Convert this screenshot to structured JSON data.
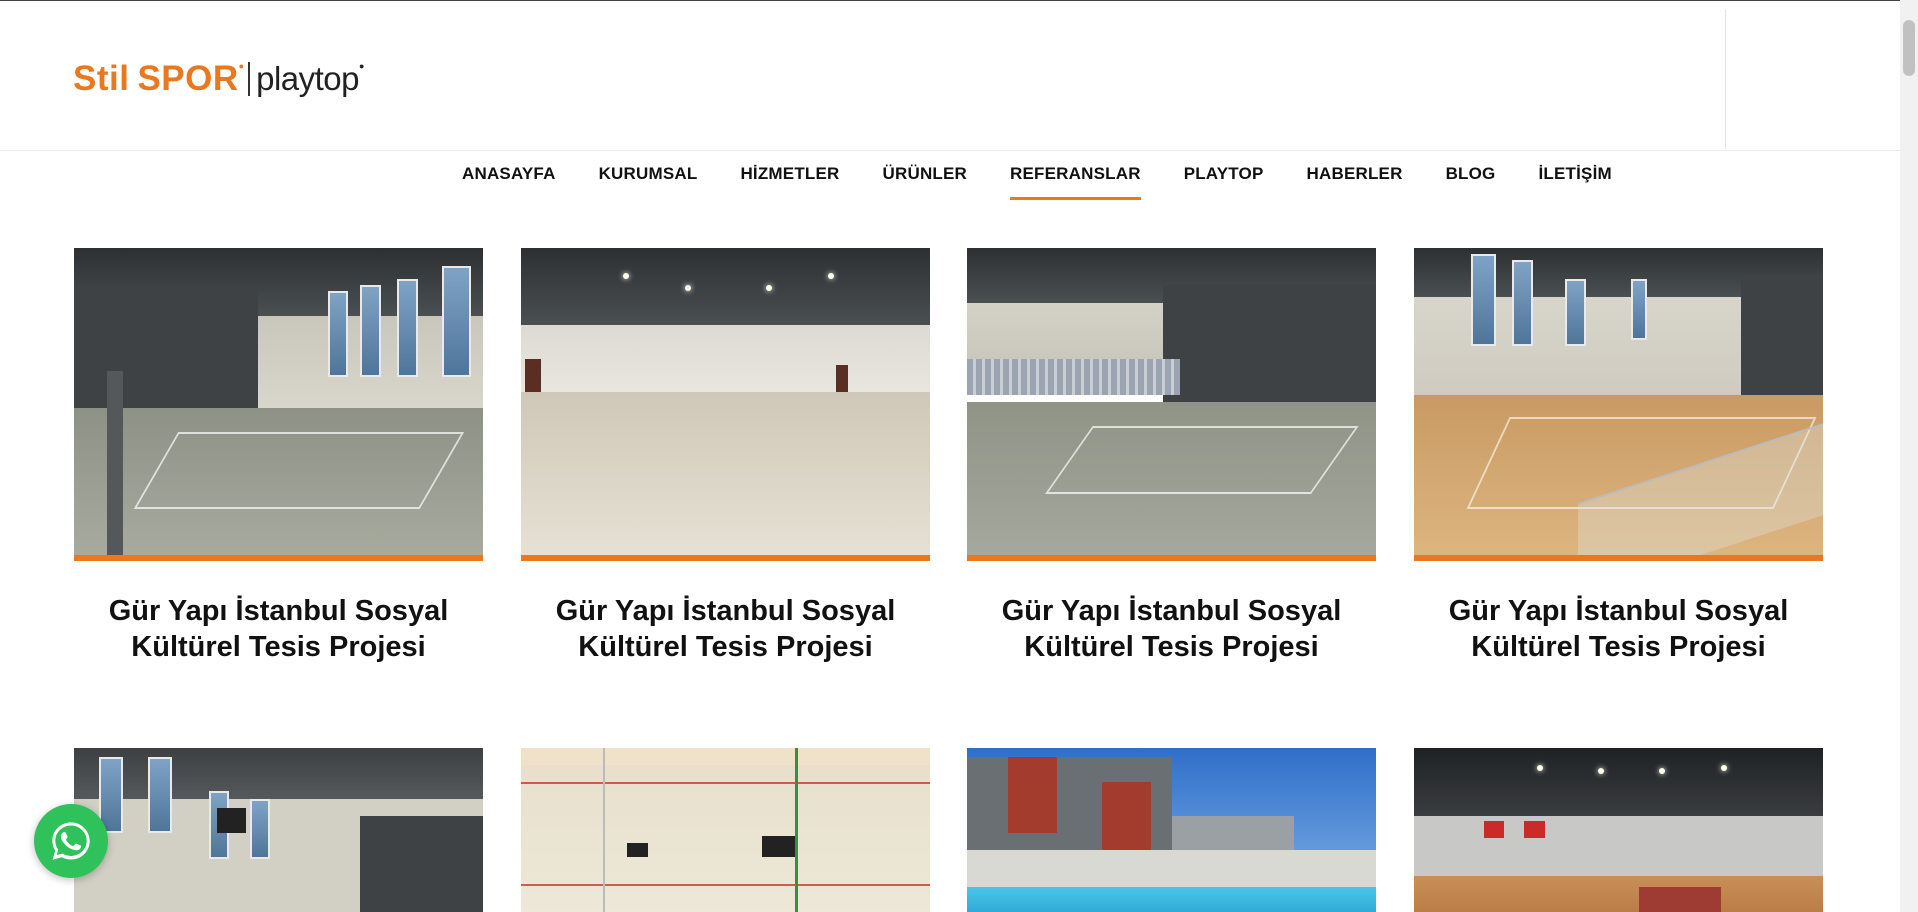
{
  "brand": {
    "logo_part1": "Stil",
    "logo_part2": "SPOR",
    "logo_part3": "playtop",
    "accent_color": "#e9781f"
  },
  "nav": {
    "items": [
      {
        "label": "ANASAYFA",
        "active": false
      },
      {
        "label": "KURUMSAL",
        "active": false
      },
      {
        "label": "HİZMETLER",
        "active": false
      },
      {
        "label": "ÜRÜNLER",
        "active": false
      },
      {
        "label": "REFERANSLAR",
        "active": true
      },
      {
        "label": "PLAYTOP",
        "active": false
      },
      {
        "label": "HABERLER",
        "active": false
      },
      {
        "label": "BLOG",
        "active": false
      },
      {
        "label": "İLETİŞİM",
        "active": false
      }
    ]
  },
  "references": {
    "row1": [
      {
        "title": "Gür Yapı İstanbul Sosyal Kültürel Tesis Projesi",
        "image": "indoor sports hall green court"
      },
      {
        "title": "Gür Yapı İstanbul Sosyal Kültürel Tesis Projesi",
        "image": "empty hall light wood floor"
      },
      {
        "title": "Gür Yapı İstanbul Sosyal Kültürel Tesis Projesi",
        "image": "sports hall with tribune"
      },
      {
        "title": "Gür Yapı İstanbul Sosyal Kültürel Tesis Projesi",
        "image": "basketball court wooden floor"
      }
    ],
    "row2": [
      {
        "image": "sports hall with windows"
      },
      {
        "image": "squash court glass wall"
      },
      {
        "image": "outdoor pool and building"
      },
      {
        "image": "indoor basketball court with flags"
      }
    ]
  },
  "floating": {
    "whatsapp_icon": "whatsapp-icon",
    "whatsapp_color": "#2fc15a"
  }
}
